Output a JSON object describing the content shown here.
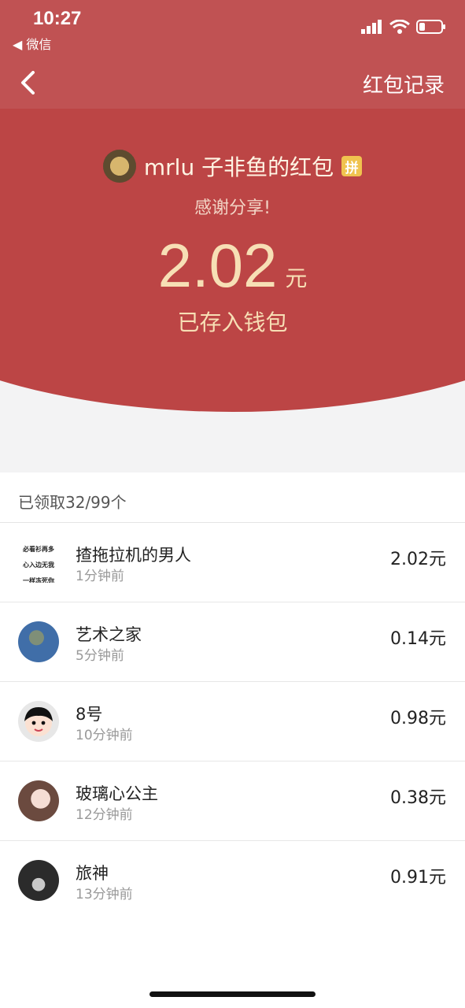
{
  "status_bar": {
    "time": "10:27",
    "back_app_label": "◀ 微信"
  },
  "nav": {
    "back_icon": "chevron-left-icon",
    "record_label": "红包记录"
  },
  "red_packet": {
    "sender_title": "mrlu 子非鱼的红包",
    "pin_badge": "拼",
    "greeting": "感谢分享!",
    "amount": "2.02",
    "amount_unit": "元",
    "deposit_text": "已存入钱包"
  },
  "list_header": "已领取32/99个",
  "recipients": [
    {
      "name": "揸拖拉机的男人",
      "time": "1分钟前",
      "amount": "2.02元",
      "avatar_text": [
        "必看衫再多",
        "心入边无我",
        "一样冻死你"
      ]
    },
    {
      "name": "艺术之家",
      "time": "5分钟前",
      "amount": "0.14元"
    },
    {
      "name": "8号",
      "time": "10分钟前",
      "amount": "0.98元"
    },
    {
      "name": "玻璃心公主",
      "time": "12分钟前",
      "amount": "0.38元"
    },
    {
      "name": "旅神",
      "time": "13分钟前",
      "amount": "0.91元"
    }
  ],
  "colors": {
    "header_red": "#bc4545",
    "nav_red": "#c05253",
    "gold_text": "#f7dfb5"
  }
}
